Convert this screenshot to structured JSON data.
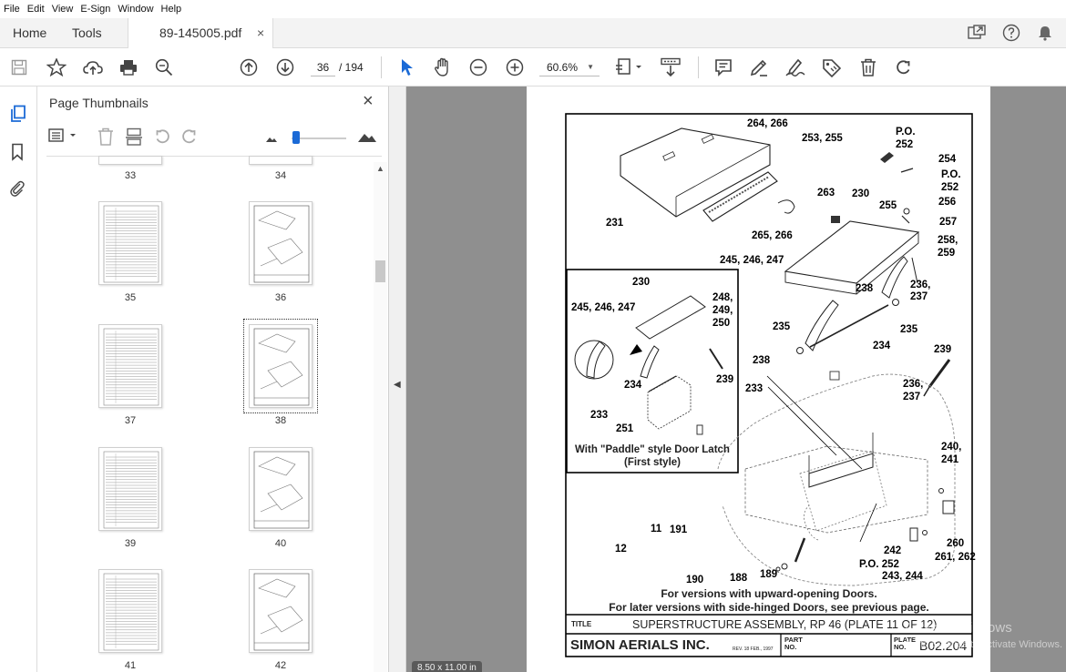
{
  "menu": {
    "items": [
      "File",
      "Edit",
      "View",
      "E-Sign",
      "Window",
      "Help"
    ]
  },
  "tabs": {
    "home": "Home",
    "tools": "Tools",
    "file": "89-145005.pdf",
    "close": "×"
  },
  "toolbar": {
    "page_current": "36",
    "page_total": "/ 194",
    "zoom": "60.6%"
  },
  "panel": {
    "title": "Page Thumbnails",
    "close": "×",
    "page_labels": {
      "p33": "33",
      "p34": "34",
      "p35": "35",
      "p36": "36",
      "p37": "37",
      "p38": "38",
      "p39": "39",
      "p40": "40",
      "p41": "41",
      "p42": "42"
    }
  },
  "document": {
    "callouts": {
      "c264": "264, 266",
      "c253": "253, 255",
      "po1": "P.O.",
      "c252a": "252",
      "c254": "254",
      "po2": "P.O.",
      "c252b": "252",
      "c231": "231",
      "c263": "263",
      "c230a": "230",
      "c255": "255",
      "c256": "256",
      "c257": "257",
      "c265": "265, 266",
      "c258": "258,",
      "c259": "259",
      "c245a": "245, 246, 247",
      "c236a": "236,",
      "c237a": "237",
      "c238a": "238",
      "c235a": "235",
      "c235b": "235",
      "c234a": "234",
      "c239a": "239",
      "c238b": "238",
      "c233a": "233",
      "c236b": "236,",
      "c237b": "237",
      "c240": "240,",
      "c241": "241",
      "c230b": "230",
      "c245b": "245, 246, 247",
      "c248": "248,",
      "c249": "249,",
      "c250": "250",
      "c239b": "239",
      "c234b": "234",
      "c233b": "233",
      "c251": "251",
      "c11": "11",
      "c191": "191",
      "c12": "12",
      "c190": "190",
      "c188": "188",
      "c189": "189",
      "c242": "242",
      "c260": "260",
      "c261": "261, 262",
      "po3": "P.O. 252",
      "c243": "243, 244"
    },
    "inset_caption_1": "With \"Paddle\" style Door Latch",
    "inset_caption_2": "(First style)",
    "note_1": "For versions with upward-opening Doors.",
    "note_2": "For later versions with side-hinged Doors, see previous page.",
    "title_label": "TITLE",
    "title_text": "SUPERSTRUCTURE ASSEMBLY, RP 46 (PLATE 11 OF 12)",
    "company": "SIMON AERIALS INC.",
    "rev": "REV. 18 FEB., 1997",
    "part_label": "PART NO.",
    "plate_label": "PLATE NO.",
    "plate_no": "B02.204"
  },
  "page_size_badge": "8.50 x 11.00 in",
  "watermark": {
    "line1": "Activate Windows",
    "line2": "Go to Settings to activate Windows."
  }
}
